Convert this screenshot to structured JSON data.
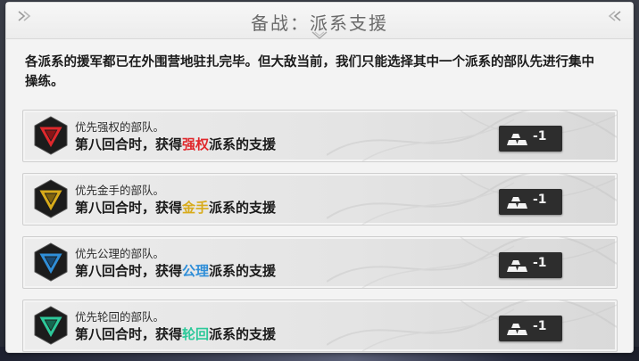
{
  "dialog": {
    "title": "备战：派系支援",
    "description": "各派系的援军都已在外围营地驻扎完毕。但大敌当前，我们只能选择其中一个派系的部队先进行集中操练。"
  },
  "options": [
    {
      "subtitle": "优先强权的部队。",
      "main_prefix": "第八回合时，获得",
      "faction": "强权",
      "main_suffix": "派系的支援",
      "color": "#e0282c",
      "cost": "-1",
      "emblem_icon": "faction-emblem-red-icon"
    },
    {
      "subtitle": "优先金手的部队。",
      "main_prefix": "第八回合时，获得",
      "faction": "金手",
      "main_suffix": "派系的支援",
      "color": "#d8ab1a",
      "cost": "-1",
      "emblem_icon": "faction-emblem-gold-icon"
    },
    {
      "subtitle": "优先公理的部队。",
      "main_prefix": "第八回合时，获得",
      "faction": "公理",
      "main_suffix": "派系的支援",
      "color": "#2f8ed8",
      "cost": "-1",
      "emblem_icon": "faction-emblem-blue-icon"
    },
    {
      "subtitle": "优先轮回的部队。",
      "main_prefix": "第八回合时，获得",
      "faction": "轮回",
      "main_suffix": "派系的支援",
      "color": "#2dc99a",
      "cost": "-1",
      "emblem_icon": "faction-emblem-green-icon"
    }
  ]
}
